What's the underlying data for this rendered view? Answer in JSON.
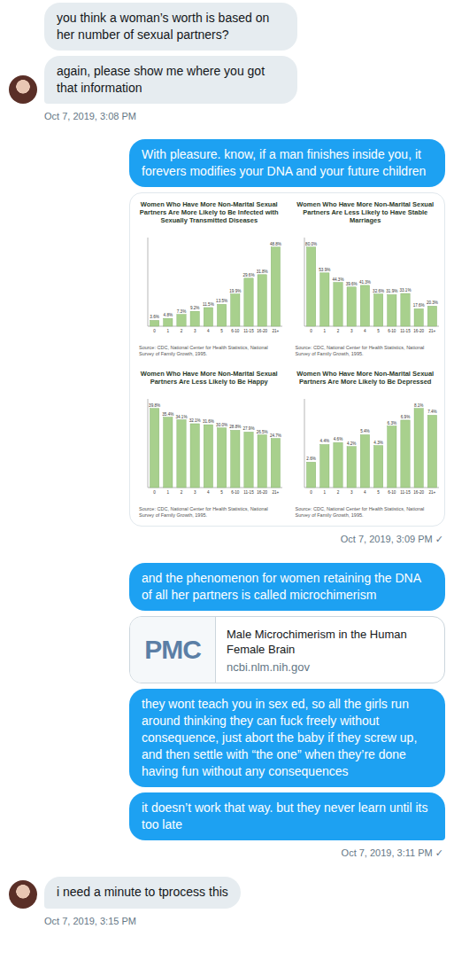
{
  "conversation": [
    {
      "side": "received",
      "time": "Oct 7, 2019, 3:08 PM",
      "receipt": "",
      "items": [
        {
          "kind": "text",
          "text": "you think a woman’s worth is based on her number of sexual partners?"
        },
        {
          "kind": "text",
          "text": "again, please show me where you got that information"
        }
      ]
    },
    {
      "side": "sent",
      "time": "Oct 7, 2019, 3:09 PM",
      "receipt": "✓",
      "items": [
        {
          "kind": "text",
          "text": "With pleasure. know, if a man finishes inside you, it forevers modifies your DNA and your future children"
        },
        {
          "kind": "charts",
          "charts": [
            {
              "title": "Women Who Have More Non-Marital Sexual Partners Are More Likely to Be Infected with Sexually Transmitted Diseases",
              "categories": [
                "0",
                "1",
                "2",
                "3",
                "4",
                "5",
                "6-10",
                "11-15",
                "16-20",
                "21+"
              ],
              "values": [
                3.6,
                4.8,
                7.3,
                9.2,
                11.5,
                13.5,
                19.9,
                29.6,
                31.8,
                48.8
              ],
              "labels": [
                "3.6%",
                "4.8%",
                "7.3%",
                "9.2%",
                "11.5%",
                "13.5%",
                "19.9%",
                "29.6%",
                "31.8%",
                "48.8%"
              ],
              "source": "Source: CDC, National Center for Health Statistics, National Survey of Family Growth, 1995."
            },
            {
              "title": "Women Who Have More Non-Marital Sexual Partners Are Less Likely to Have Stable Marriages",
              "categories": [
                "0",
                "1",
                "2",
                "3",
                "4",
                "5",
                "6-10",
                "11-15",
                "16-20",
                "21+"
              ],
              "values": [
                80.0,
                53.9,
                44.3,
                39.6,
                41.3,
                32.6,
                31.9,
                33.1,
                17.6,
                20.3
              ],
              "labels": [
                "80.0%",
                "53.9%",
                "44.3%",
                "39.6%",
                "41.3%",
                "32.6%",
                "31.9%",
                "33.1%",
                "17.6%",
                "20.3%"
              ],
              "source": "Source: CDC, National Center for Health Statistics, National Survey of Family Growth, 1995."
            },
            {
              "title": "Women Who Have More Non-Marital Sexual Partners Are Less Likely to Be Happy",
              "categories": [
                "0",
                "1",
                "2",
                "3",
                "4",
                "5",
                "6-10",
                "11-15",
                "16-20",
                "21+"
              ],
              "values": [
                39.8,
                35.4,
                34.1,
                32.1,
                31.6,
                30.0,
                28.8,
                27.9,
                26.5,
                24.7
              ],
              "labels": [
                "39.8%",
                "35.4%",
                "34.1%",
                "32.1%",
                "31.6%",
                "30.0%",
                "28.8%",
                "27.9%",
                "26.5%",
                "24.7%"
              ],
              "source": "Source: CDC, National Center for Health Statistics, National Survey of Family Growth, 1995."
            },
            {
              "title": "Women Who Have More Non-Marital Sexual Partners Are More Likely to Be Depressed",
              "categories": [
                "0",
                "1",
                "2",
                "3",
                "4",
                "5",
                "6-10",
                "11-15",
                "16-20",
                "21+"
              ],
              "values": [
                2.6,
                4.4,
                4.6,
                4.2,
                5.4,
                4.3,
                6.3,
                6.9,
                8.1,
                7.4
              ],
              "labels": [
                "2.6%",
                "4.4%",
                "4.6%",
                "4.2%",
                "5.4%",
                "4.3%",
                "6.3%",
                "6.9%",
                "8.1%",
                "7.4%"
              ],
              "source": "Source: CDC, National Center for Health Statistics, National Survey of Family Growth, 1995."
            }
          ]
        }
      ]
    },
    {
      "side": "sent",
      "time": "Oct 7, 2019, 3:11 PM",
      "receipt": "✓",
      "items": [
        {
          "kind": "text",
          "text": "and the phenomenon for women retaining the DNA of all her partners is called microchimerism"
        },
        {
          "kind": "link",
          "thumbnail": "PMC",
          "title": "Male Microchimerism in the Human Female Brain",
          "domain": "ncbi.nlm.nih.gov"
        },
        {
          "kind": "text",
          "text": "they wont teach you in sex ed, so all the girls run around thinking they can fuck freely without consequence, just abort the baby if they screw up, and then settle with “the one” when they’re done having fun without any consequences"
        },
        {
          "kind": "text",
          "text": "it doesn’t work that way. but they never learn until its too late"
        }
      ]
    },
    {
      "side": "received",
      "time": "Oct 7, 2019, 3:15 PM",
      "receipt": "",
      "items": [
        {
          "kind": "text",
          "text": "i need a minute to tprocess this"
        }
      ]
    }
  ]
}
